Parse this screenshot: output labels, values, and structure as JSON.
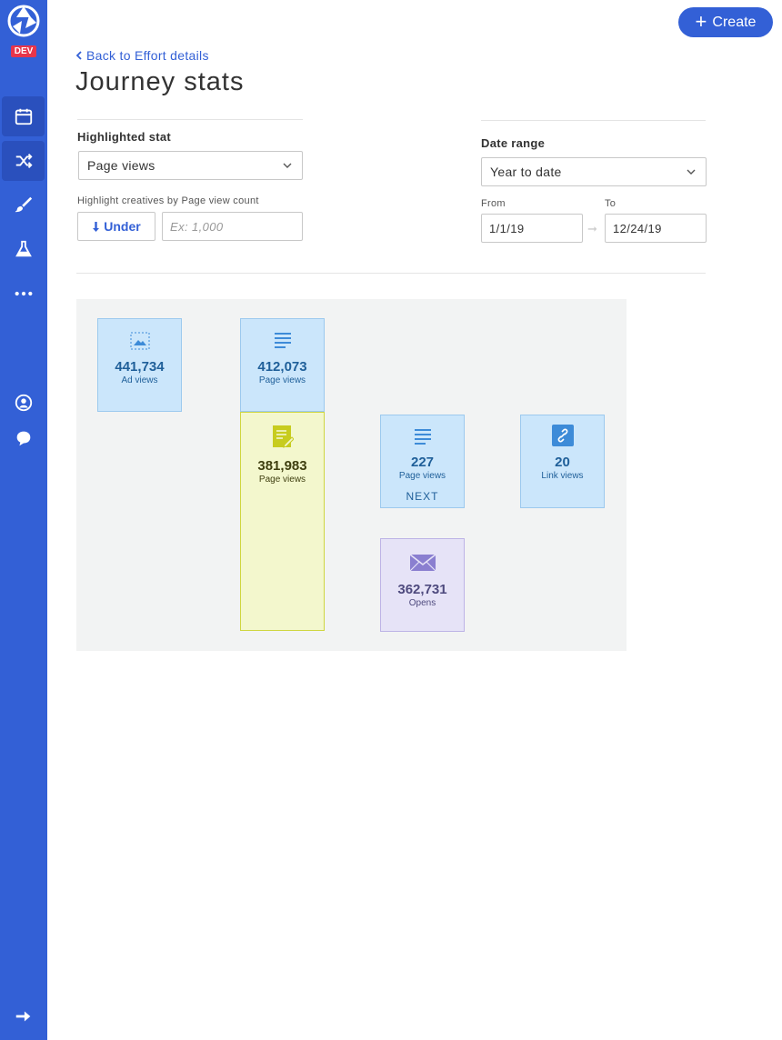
{
  "sidebar": {
    "badge": "DEV",
    "items": [
      {
        "icon": "calendar-icon"
      },
      {
        "icon": "shuffle-icon"
      },
      {
        "icon": "brush-icon"
      },
      {
        "icon": "flask-icon"
      },
      {
        "icon": "more-icon"
      },
      {
        "icon": "user-circle-icon"
      },
      {
        "icon": "chat-icon"
      },
      {
        "icon": "arrow-right-icon"
      }
    ]
  },
  "header": {
    "create_label": "Create",
    "back_label": "Back to Effort details",
    "title": "Journey stats"
  },
  "highlight": {
    "label": "Highlighted stat",
    "selected": "Page views",
    "hint": "Highlight creatives by Page view count",
    "under_label": "Under",
    "input_placeholder": "Ex: 1,000"
  },
  "date_range": {
    "label": "Date range",
    "selected": "Year to date",
    "from_label": "From",
    "from_value": "1/1/19",
    "to_label": "To",
    "to_value": "12/24/19"
  },
  "journey": {
    "nodes": [
      {
        "value": "441,734",
        "metric": "Ad views",
        "type": "ad"
      },
      {
        "value": "412,073",
        "metric": "Page views",
        "type": "page"
      },
      {
        "value": "381,983",
        "metric": "Page views",
        "type": "form"
      },
      {
        "value": "227",
        "metric": "Page views",
        "type": "page",
        "tag": "NEXT"
      },
      {
        "value": "20",
        "metric": "Link views",
        "type": "link"
      },
      {
        "value": "362,731",
        "metric": "Opens",
        "type": "email"
      }
    ]
  },
  "colors": {
    "brand": "#3360d6",
    "node_blue": "#cbe6fb",
    "node_yellow": "#f3f7cd",
    "node_purple": "#e6e3f7"
  }
}
